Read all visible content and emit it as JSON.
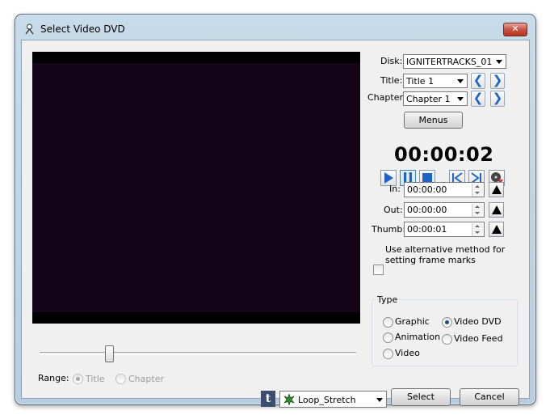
{
  "window": {
    "title": "Select Video DVD",
    "close_label": "✕"
  },
  "disk": {
    "label": "Disk:",
    "value": "IGNITERTRACKS_01"
  },
  "title_sel": {
    "label": "Title:",
    "value": "Title 1",
    "prev": "❮",
    "next": "❯"
  },
  "chapter_sel": {
    "label": "Chapter",
    "value": "Chapter 1",
    "prev": "❮",
    "next": "❯"
  },
  "menus_label": "Menus",
  "timecode": "00:00:02",
  "transport_icons": [
    "play-icon",
    "pause-icon",
    "stop-icon",
    "skip-back-icon",
    "skip-forward-icon",
    "eject-disc-icon"
  ],
  "marks": {
    "in": {
      "label": "In:",
      "value": "00:00:00"
    },
    "out": {
      "label": "Out:",
      "value": "00:00:00"
    },
    "thumb": {
      "label": "Thumb:",
      "value": "00:00:01"
    }
  },
  "alt_method": {
    "label_line1": "Use alternative method for",
    "label_line2": "setting frame marks",
    "checked": false
  },
  "type_group": {
    "title": "Type",
    "options": [
      {
        "label": "Graphic",
        "selected": false
      },
      {
        "label": "Video DVD",
        "selected": true
      },
      {
        "label": "Animation",
        "selected": false
      },
      {
        "label": "Video Feed",
        "selected": false
      },
      {
        "label": "Video",
        "selected": false
      }
    ]
  },
  "range": {
    "label": "Range:",
    "title_label": "Title",
    "chapter_label": "Chapter",
    "selected": "Title",
    "enabled": false
  },
  "position_slider": {
    "value_fraction": 0.22
  },
  "transition": {
    "value": "Loop_Stretch",
    "badge": "t"
  },
  "buttons": {
    "select": "Select",
    "cancel": "Cancel"
  },
  "colors": {
    "accent_blue": "#1e64c8",
    "video_bg": "#130517",
    "frame": "#b7cde0"
  }
}
